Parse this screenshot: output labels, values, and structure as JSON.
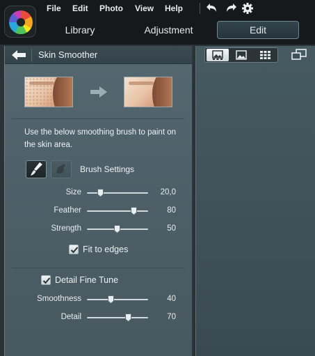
{
  "menu": {
    "file": "File",
    "edit": "Edit",
    "photo": "Photo",
    "view": "View",
    "help": "Help"
  },
  "toolbar_icons": [
    "undo-icon",
    "redo-icon",
    "settings-gear-icon"
  ],
  "mode_tabs": {
    "library": "Library",
    "adjustment": "Adjustment",
    "edit": "Edit",
    "active": "Edit"
  },
  "panel": {
    "title": "Skin Smoother",
    "instruction": "Use the below smoothing brush to paint on the skin area.",
    "brush_settings_label": "Brush Settings",
    "brush": {
      "size": {
        "label": "Size",
        "value": "20,0",
        "fraction": 0.15
      },
      "feather": {
        "label": "Feather",
        "value": "80",
        "fraction": 0.8
      },
      "strength": {
        "label": "Strength",
        "value": "50",
        "fraction": 0.5
      }
    },
    "fit_to_edges": {
      "label": "Fit to edges",
      "checked": true
    },
    "detail_fine_tune": {
      "label": "Detail Fine Tune",
      "checked": true
    },
    "fine_tune": {
      "smoothness": {
        "label": "Smoothness",
        "value": "40",
        "fraction": 0.4
      },
      "detail": {
        "label": "Detail",
        "value": "70",
        "fraction": 0.7
      }
    }
  },
  "colors": {
    "accent_border": "#6f8a96",
    "panel_bg": "#4e6069",
    "topbar_bg": "#15191b"
  }
}
